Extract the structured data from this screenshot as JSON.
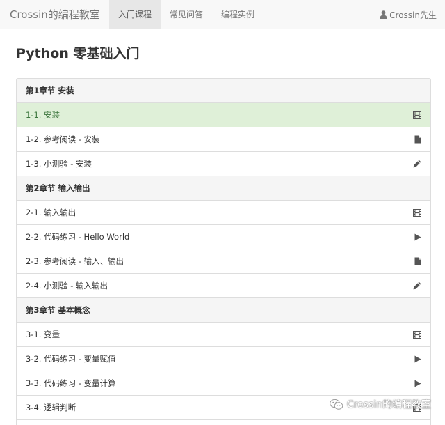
{
  "navbar": {
    "brand": "Crossin的编程教室",
    "items": [
      {
        "label": "入门课程",
        "active": true
      },
      {
        "label": "常见问答",
        "active": false
      },
      {
        "label": "编程实例",
        "active": false
      }
    ],
    "user": {
      "name": "Crossin先生",
      "icon": "user-icon"
    }
  },
  "page": {
    "title": "Python 零基础入门"
  },
  "colors": {
    "active_row_bg": "#dff0d8",
    "active_row_text": "#3c763d",
    "chapter_bg": "#f5f5f5"
  },
  "rows": [
    {
      "type": "chapter",
      "label": "第1章节 安装"
    },
    {
      "type": "lesson",
      "label": "1-1. 安装",
      "icon": "film",
      "active": true
    },
    {
      "type": "lesson",
      "label": "1-2. 参考阅读 - 安装",
      "icon": "file"
    },
    {
      "type": "lesson",
      "label": "1-3. 小测验 - 安装",
      "icon": "pencil"
    },
    {
      "type": "chapter",
      "label": "第2章节 输入输出"
    },
    {
      "type": "lesson",
      "label": "2-1. 输入输出",
      "icon": "film"
    },
    {
      "type": "lesson",
      "label": "2-2. 代码练习 - Hello World",
      "icon": "play"
    },
    {
      "type": "lesson",
      "label": "2-3. 参考阅读 - 输入、输出",
      "icon": "file"
    },
    {
      "type": "lesson",
      "label": "2-4. 小测验 - 输入输出",
      "icon": "pencil"
    },
    {
      "type": "chapter",
      "label": "第3章节 基本概念"
    },
    {
      "type": "lesson",
      "label": "3-1. 变量",
      "icon": "film"
    },
    {
      "type": "lesson",
      "label": "3-2. 代码练习 - 变量赋值",
      "icon": "play"
    },
    {
      "type": "lesson",
      "label": "3-3. 代码练习 - 变量计算",
      "icon": "play"
    },
    {
      "type": "lesson",
      "label": "3-4. 逻辑判断",
      "icon": "film"
    }
  ],
  "watermark": {
    "text": "Crossin的编程教室",
    "icon": "wechat-icon"
  }
}
